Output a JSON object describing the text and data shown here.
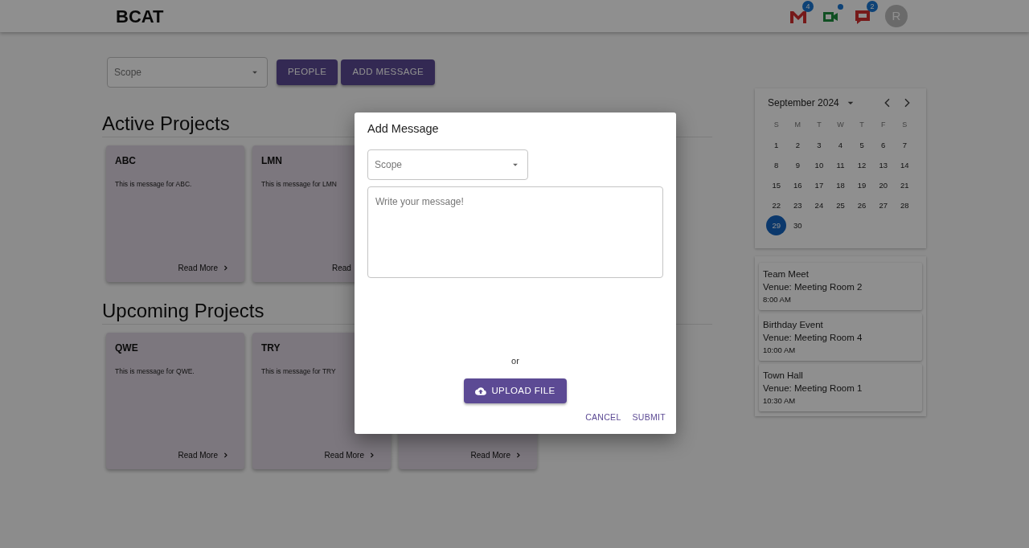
{
  "app": {
    "logo": "BCAT"
  },
  "header_icons": [
    {
      "kind": "mail",
      "badge": "4",
      "dot": false
    },
    {
      "kind": "video",
      "dot": true
    },
    {
      "kind": "chat",
      "badge": "2",
      "dot": false
    }
  ],
  "avatar": {
    "initial": "R"
  },
  "toolbar": {
    "scope_select": {
      "placeholder": "Scope"
    },
    "buttons": [
      "PEOPLE",
      "ADD MESSAGE"
    ]
  },
  "sections": [
    {
      "title": "Active Projects",
      "cards": [
        {
          "title": "ABC",
          "message": "This is message for ABC.",
          "read_more": "Read More",
          "chevron": true
        },
        {
          "title": "LMN",
          "message": "This is message for LMN",
          "read_more": "Read",
          "chevron": false
        }
      ]
    },
    {
      "title": "Upcoming Projects",
      "cards": [
        {
          "title": "QWE",
          "message": "This is message for QWE.",
          "read_more": "Read More",
          "chevron": true
        },
        {
          "title": "TRY",
          "message": "This is message for TRY",
          "read_more": "Read More",
          "chevron": true
        },
        {
          "read_more": "Read More",
          "chevron": true
        }
      ]
    }
  ],
  "calendar": {
    "month": "September 2024",
    "weekdays": [
      "S",
      "M",
      "T",
      "W",
      "T",
      "F",
      "S"
    ],
    "days": [
      {
        "label": "1",
        "selected": false
      },
      {
        "label": "2",
        "selected": false
      },
      {
        "label": "3",
        "selected": false
      },
      {
        "label": "4",
        "selected": false
      },
      {
        "label": "5",
        "selected": false
      },
      {
        "label": "6",
        "selected": false
      },
      {
        "label": "7",
        "selected": false
      },
      {
        "label": "8",
        "selected": false
      },
      {
        "label": "9",
        "selected": false
      },
      {
        "label": "10",
        "selected": false
      },
      {
        "label": "11",
        "selected": false
      },
      {
        "label": "12",
        "selected": false
      },
      {
        "label": "13",
        "selected": false
      },
      {
        "label": "14",
        "selected": false
      },
      {
        "label": "15",
        "selected": false
      },
      {
        "label": "16",
        "selected": false
      },
      {
        "label": "17",
        "selected": false
      },
      {
        "label": "18",
        "selected": false
      },
      {
        "label": "19",
        "selected": false
      },
      {
        "label": "20",
        "selected": false
      },
      {
        "label": "21",
        "selected": false
      },
      {
        "label": "22",
        "selected": false
      },
      {
        "label": "23",
        "selected": false
      },
      {
        "label": "24",
        "selected": false
      },
      {
        "label": "25",
        "selected": false
      },
      {
        "label": "26",
        "selected": false
      },
      {
        "label": "27",
        "selected": false
      },
      {
        "label": "28",
        "selected": false
      },
      {
        "label": "29",
        "selected": true
      },
      {
        "label": "30",
        "selected": false
      }
    ]
  },
  "events": [
    {
      "title": "Team Meet",
      "venue": "Venue: Meeting Room 2",
      "time": "8:00 AM"
    },
    {
      "title": "Birthday Event",
      "venue": "Venue: Meeting Room 4",
      "time": "10:00 AM"
    },
    {
      "title": "Town Hall",
      "venue": "Venue: Meeting Room 1",
      "time": "10:30 AM"
    }
  ],
  "dialog": {
    "title": "Add Message",
    "scope_select": {
      "placeholder": "Scope"
    },
    "message_field": {
      "placeholder": "Write your message!"
    },
    "separator": "or",
    "upload_button": "UPLOAD FILE",
    "actions": [
      "CANCEL",
      "SUBMIT"
    ]
  }
}
